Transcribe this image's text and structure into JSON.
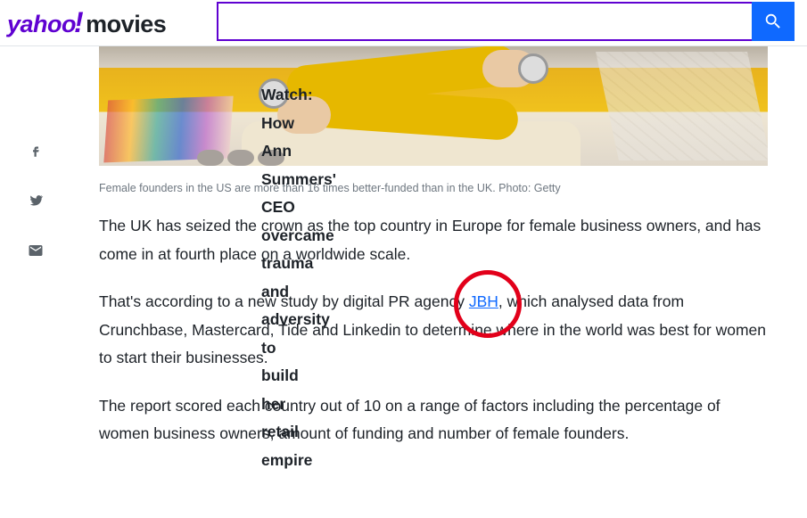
{
  "header": {
    "brand": "yahoo",
    "bang": "!",
    "section": "movies",
    "search_placeholder": ""
  },
  "article": {
    "image_caption": "Female founders in the US are more than 16 times better-funded than in the UK. Photo: Getty",
    "p1": "The UK has seized the crown as the top country in Europe for female business owners, and has come in at fourth place on a worldwide scale.",
    "p2_a": "That's according to a new study by digital PR agency ",
    "p2_link": "JBH",
    "p2_b": ", which analysed data from Crunchbase, Mastercard, Tide and Linkedin to determine where in the world was best for women to start their businesses.",
    "p3": "The report scored each country out of 10 on a range of factors including the percentage of women business owners, amount of funding and number of female founders.",
    "p4": "Watch: How Ann Summers' CEO overcame trauma and adversity to build her retail empire"
  }
}
